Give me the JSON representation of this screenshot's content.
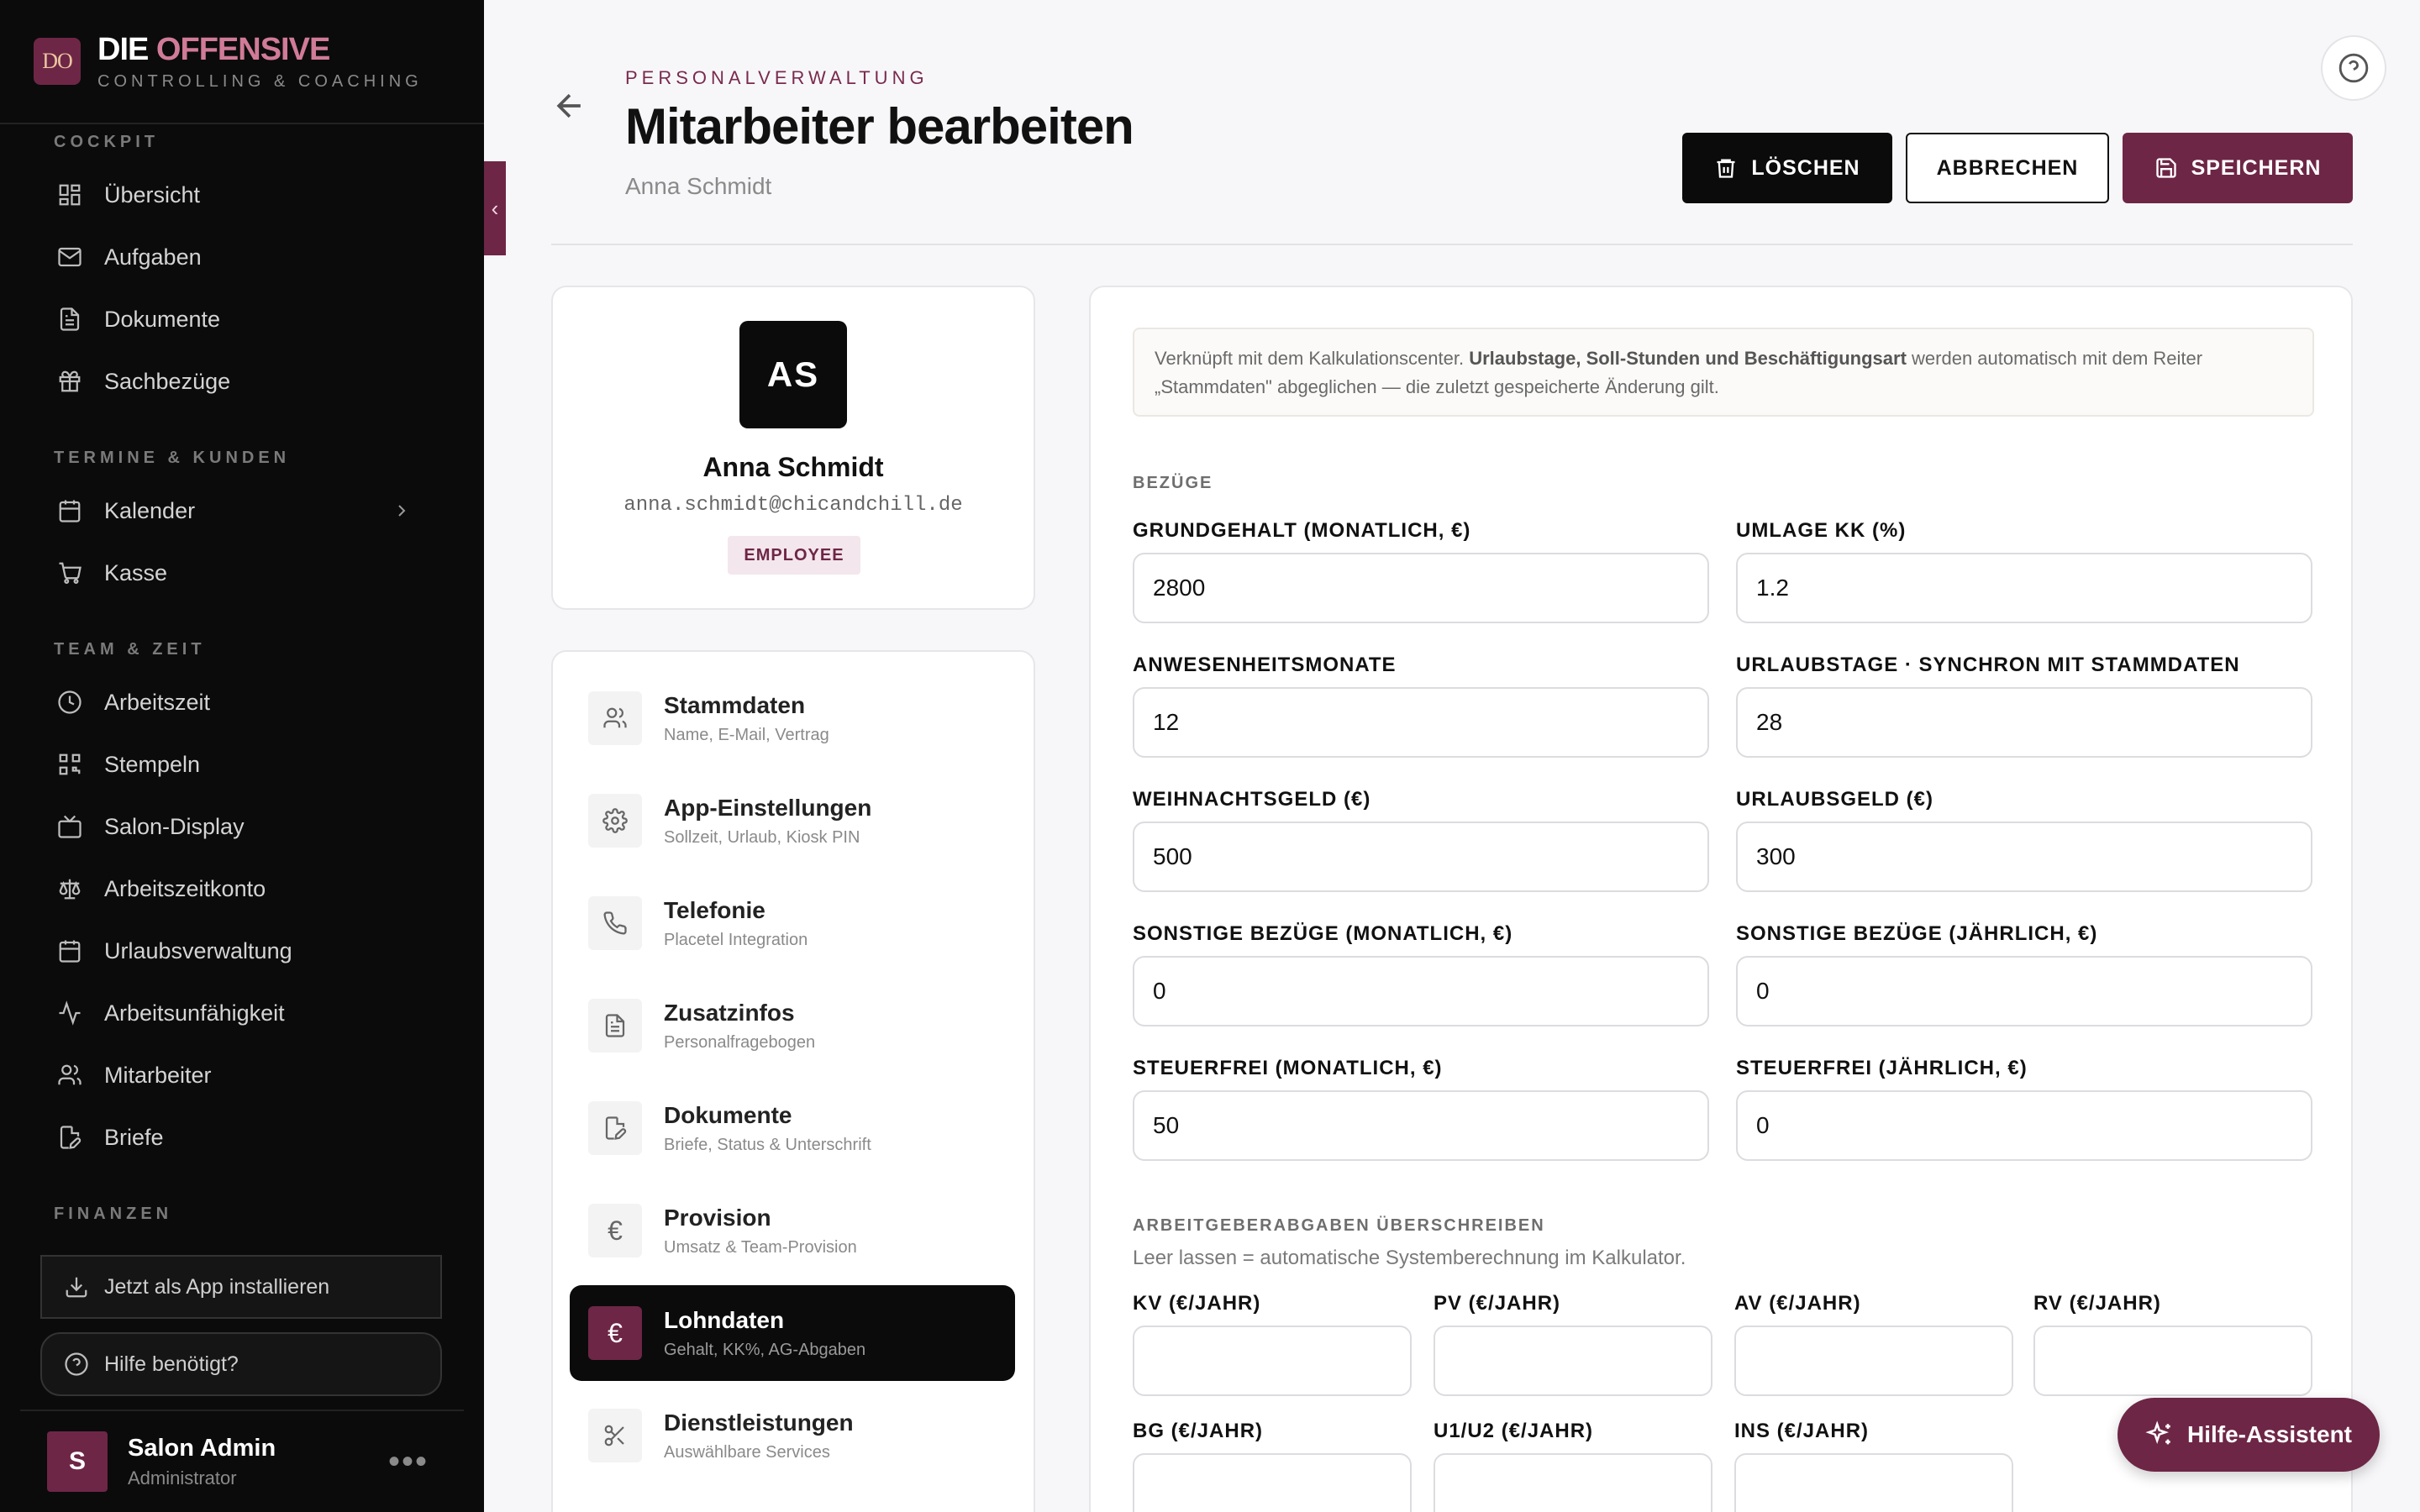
{
  "brand": {
    "logo": "DO",
    "name_part1": "DIE",
    "name_part2": "OFFENSIVE",
    "subtitle": "CONTROLLING & COACHING"
  },
  "sidebar": {
    "sections": [
      "COCKPIT",
      "TERMINE & KUNDEN",
      "TEAM & ZEIT",
      "FINANZEN"
    ],
    "cockpit": [
      {
        "label": "Übersicht",
        "icon": "dashboard-icon"
      },
      {
        "label": "Aufgaben",
        "icon": "mail-icon"
      },
      {
        "label": "Dokumente",
        "icon": "document-icon"
      },
      {
        "label": "Sachbezüge",
        "icon": "gift-icon"
      }
    ],
    "termine": [
      {
        "label": "Kalender",
        "icon": "calendar-icon"
      },
      {
        "label": "Kasse",
        "icon": "cart-icon"
      }
    ],
    "team": [
      {
        "label": "Arbeitszeit",
        "icon": "clock-icon"
      },
      {
        "label": "Stempeln",
        "icon": "qr-code-icon"
      },
      {
        "label": "Salon-Display",
        "icon": "tv-icon"
      },
      {
        "label": "Arbeitszeitkonto",
        "icon": "scale-icon"
      },
      {
        "label": "Urlaubsverwaltung",
        "icon": "calendar-icon"
      },
      {
        "label": "Arbeitsunfähigkeit",
        "icon": "activity-icon"
      },
      {
        "label": "Mitarbeiter",
        "icon": "users-icon"
      },
      {
        "label": "Briefe",
        "icon": "edit-document-icon"
      }
    ],
    "install_label": "Jetzt als App installieren",
    "help_label": "Hilfe benötigt?",
    "user": {
      "initial": "S",
      "name": "Salon Admin",
      "role": "Administrator"
    }
  },
  "header": {
    "breadcrumb": "PERSONALVERWALTUNG",
    "title": "Mitarbeiter bearbeiten",
    "subtitle": "Anna Schmidt",
    "delete_label": "LÖSCHEN",
    "cancel_label": "ABBRECHEN",
    "save_label": "SPEICHERN"
  },
  "employee": {
    "initials": "AS",
    "name": "Anna Schmidt",
    "email": "anna.schmidt@chicandchill.de",
    "role": "EMPLOYEE"
  },
  "nav_items": [
    {
      "title": "Stammdaten",
      "sub": "Name, E-Mail, Vertrag",
      "icon": "users-icon"
    },
    {
      "title": "App-Einstellungen",
      "sub": "Sollzeit, Urlaub, Kiosk PIN",
      "icon": "gear-icon"
    },
    {
      "title": "Telefonie",
      "sub": "Placetel Integration",
      "icon": "phone-icon"
    },
    {
      "title": "Zusatzinfos",
      "sub": "Personalfragebogen",
      "icon": "document-icon"
    },
    {
      "title": "Dokumente",
      "sub": "Briefe, Status & Unterschrift",
      "icon": "edit-document-icon"
    },
    {
      "title": "Provision",
      "sub": "Umsatz & Team-Provision",
      "icon": "euro-icon"
    },
    {
      "title": "Lohndaten",
      "sub": "Gehalt, KK%, AG-Abgaben",
      "icon": "euro-icon",
      "active": true
    },
    {
      "title": "Dienstleistungen",
      "sub": "Auswählbare Services",
      "icon": "scissors-icon"
    }
  ],
  "form": {
    "info_prefix": "Verknüpft mit dem Kalkulationscenter. ",
    "info_bold": "Urlaubstage, Soll-Stunden und Beschäftigungsart",
    "info_suffix": " werden automatisch mit dem Reiter „Stammdaten\" abgeglichen — die zuletzt gespeicherte Änderung gilt.",
    "section_bezuege": "BEZÜGE",
    "fields": [
      {
        "label": "GRUNDGEHALT (MONATLICH, €)",
        "value": "2800"
      },
      {
        "label": "UMLAGE KK (%)",
        "value": "1.2"
      },
      {
        "label": "ANWESENHEITSMONATE",
        "value": "12"
      },
      {
        "label": "URLAUBSTAGE · SYNCHRON MIT STAMMDATEN",
        "value": "28"
      },
      {
        "label": "WEIHNACHTSGELD (€)",
        "value": "500"
      },
      {
        "label": "URLAUBSGELD (€)",
        "value": "300"
      },
      {
        "label": "SONSTIGE BEZÜGE (MONATLICH, €)",
        "value": "0"
      },
      {
        "label": "SONSTIGE BEZÜGE (JÄHRLICH, €)",
        "value": "0"
      },
      {
        "label": "STEUERFREI (MONATLICH, €)",
        "value": "50"
      },
      {
        "label": "STEUERFREI (JÄHRLICH, €)",
        "value": "0"
      }
    ],
    "section_ag": "ARBEITGEBERABGABEN ÜBERSCHREIBEN",
    "ag_hint": "Leer lassen = automatische Systemberechnung im Kalkulator.",
    "ag_fields": [
      {
        "label": "KV (€/JAHR)",
        "value": ""
      },
      {
        "label": "PV (€/JAHR)",
        "value": ""
      },
      {
        "label": "AV (€/JAHR)",
        "value": ""
      },
      {
        "label": "RV (€/JAHR)",
        "value": ""
      },
      {
        "label": "BG (€/JAHR)",
        "value": ""
      },
      {
        "label": "U1/U2 (€/JAHR)",
        "value": ""
      },
      {
        "label": "INS (€/JAHR)",
        "value": ""
      }
    ]
  },
  "assistant_label": "Hilfe-Assistent",
  "colors": {
    "accent": "#6e2646",
    "sidebar": "#0b0b0b",
    "background": "#f7f7f9"
  }
}
